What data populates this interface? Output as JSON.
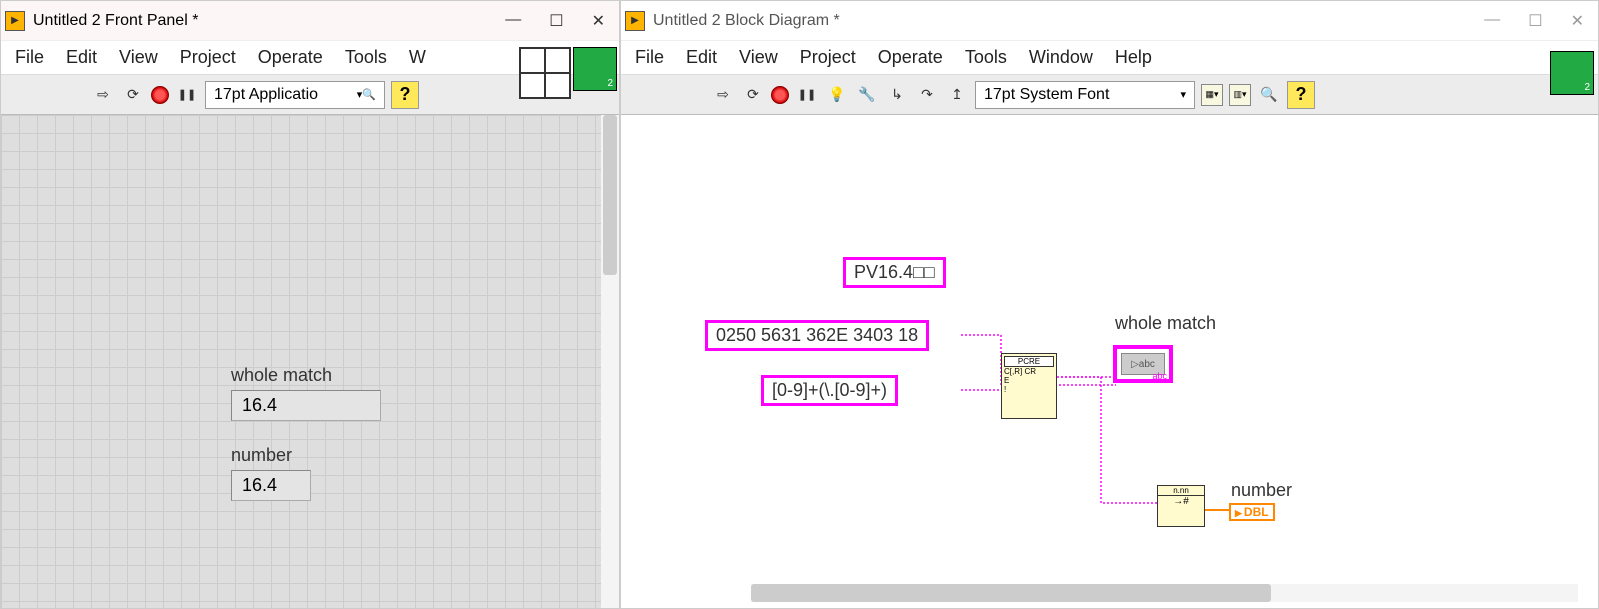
{
  "windows": {
    "front": {
      "title": "Untitled 2 Front Panel *"
    },
    "block": {
      "title": "Untitled 2 Block Diagram *"
    }
  },
  "menu": {
    "file": "File",
    "edit": "Edit",
    "view": "View",
    "project": "Project",
    "operate": "Operate",
    "tools": "Tools",
    "window": "Window",
    "help": "Help",
    "window_short": "W"
  },
  "toolbar": {
    "front_font": "17pt Applicatio",
    "block_font": "17pt System Font",
    "help": "?"
  },
  "front_panel": {
    "whole_match": {
      "label": "whole match",
      "value": "16.4"
    },
    "number": {
      "label": "number",
      "value": "16.4"
    }
  },
  "block_diagram": {
    "const1": "PV16.4□□",
    "const2": "0250 5631 362E 3403 18",
    "const3": "[0-9]+(\\.[0-9]+)",
    "whole_match_label": "whole match",
    "number_label": "number",
    "abc": "abc",
    "dbl": "DBL",
    "pcre": "PCRE",
    "n_nn": "n.nn"
  }
}
